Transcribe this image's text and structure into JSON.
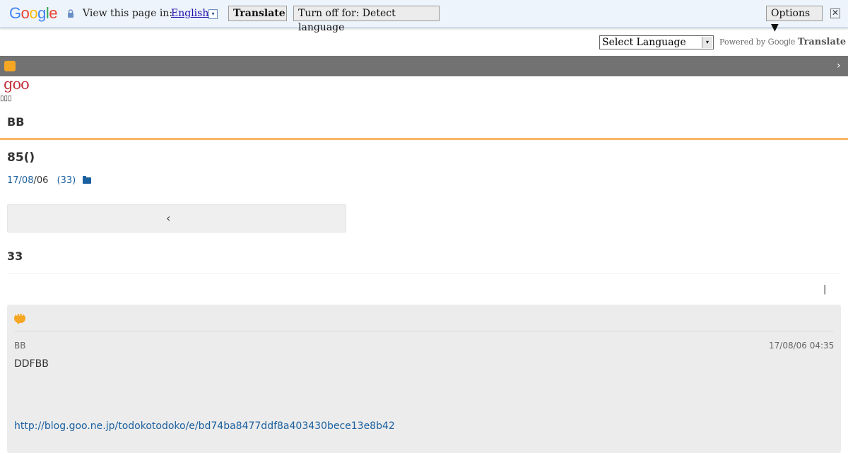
{
  "translate_bar": {
    "logo_letters": [
      "G",
      "o",
      "o",
      "g",
      "l",
      "e"
    ],
    "view_text": "View this page in:",
    "language": "English",
    "lang_arrow": "▾",
    "translate_button": "Translate",
    "turn_off_button": "Turn off for: Detect language",
    "options_button": "Options ▼",
    "close_glyph": "✕"
  },
  "language_widget": {
    "select_value": "Select Language",
    "dropdown_glyph": "▾",
    "powered_by": "Powered by",
    "google_word": "Google",
    "translate_word": "Translate"
  },
  "header": {
    "chevron_glyph": "›",
    "goo_logo": "goo",
    "tofu": "▯▯▯",
    "blog_title": "BB",
    "accent_color": "#f8b563"
  },
  "post": {
    "title": "85()",
    "date_link": "17/08",
    "date_rest": "/06",
    "comments_link": "(33)",
    "prev_chevron": "‹"
  },
  "comments": {
    "count": "33",
    "pipe": "|",
    "items": [
      {
        "author": "BB",
        "date": "17/08/06 04:35",
        "body": "DDFBB",
        "url": "http://blog.goo.ne.jp/todokotodoko/e/bd74ba8477ddf8a403430bece13e8b42"
      }
    ]
  }
}
